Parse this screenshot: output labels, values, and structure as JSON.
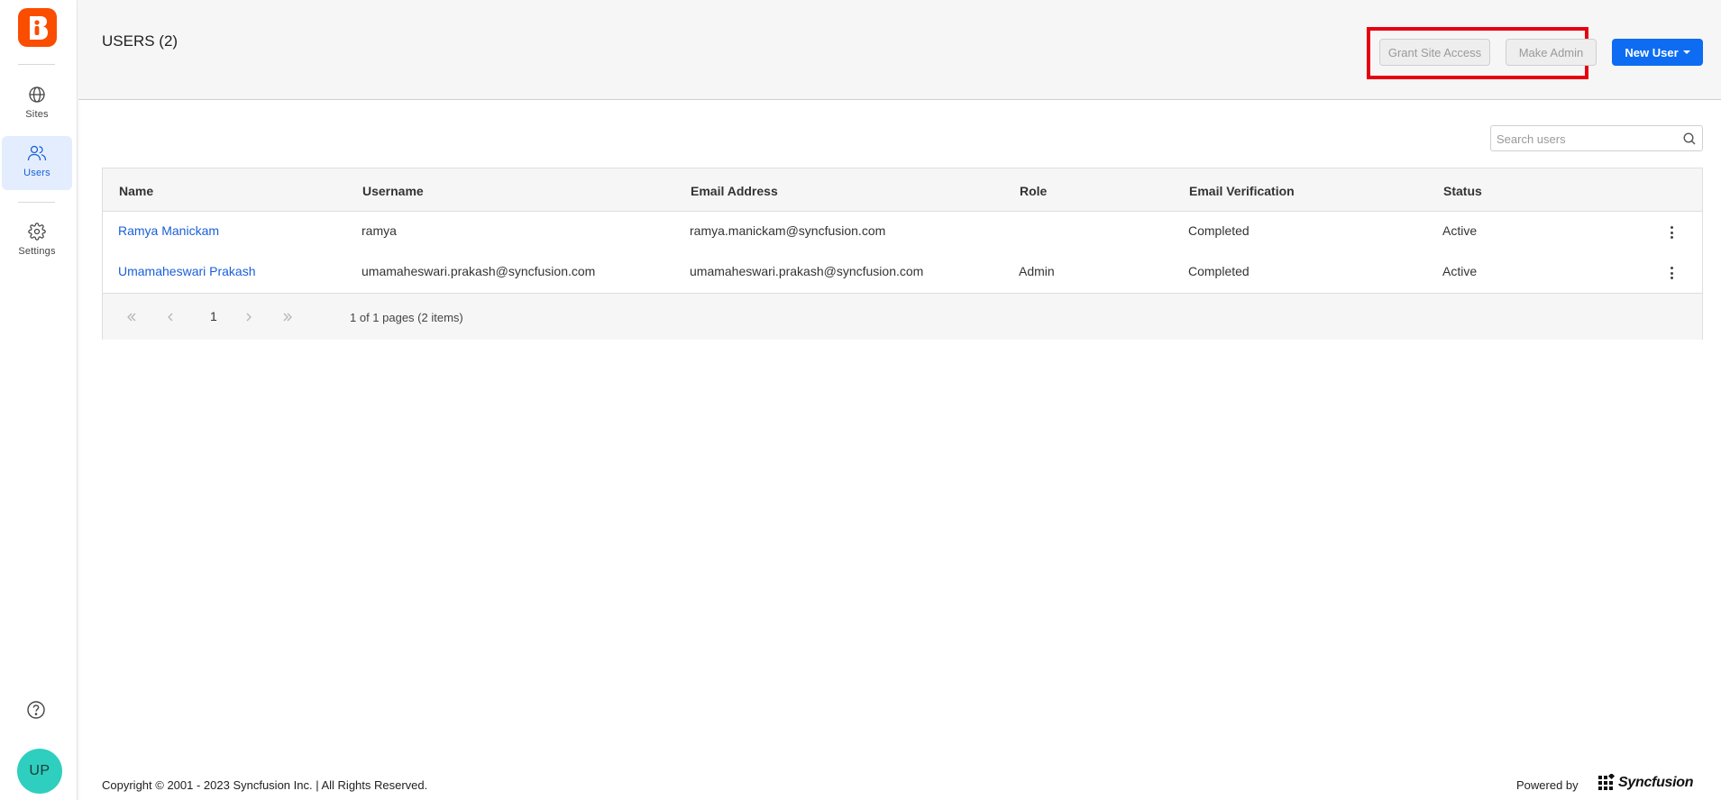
{
  "sidebar": {
    "items": [
      {
        "label": "Sites",
        "icon": "globe-icon",
        "active": false
      },
      {
        "label": "Users",
        "icon": "users-icon",
        "active": true
      },
      {
        "label": "Settings",
        "icon": "gear-icon",
        "active": false
      }
    ],
    "avatar_initials": "UP"
  },
  "header": {
    "title": "USERS (2)",
    "grant_site_access_label": "Grant Site Access",
    "make_admin_label": "Make Admin",
    "new_user_label": "New User"
  },
  "search": {
    "placeholder": "Search users"
  },
  "table": {
    "columns": [
      "Name",
      "Username",
      "Email Address",
      "Role",
      "Email Verification",
      "Status"
    ],
    "rows": [
      {
        "name": "Ramya Manickam",
        "username": "ramya",
        "email": "ramya.manickam@syncfusion.com",
        "role": "",
        "verification": "Completed",
        "status": "Active"
      },
      {
        "name": "Umamaheswari Prakash",
        "username": "umamaheswari.prakash@syncfusion.com",
        "email": "umamaheswari.prakash@syncfusion.com",
        "role": "Admin",
        "verification": "Completed",
        "status": "Active"
      }
    ]
  },
  "pager": {
    "current_page": "1",
    "info": "1 of 1 pages (2 items)"
  },
  "footer": {
    "copyright": "Copyright © 2001 - 2023 Syncfusion Inc. | All Rights Reserved.",
    "powered_by": "Powered by",
    "brand": "Syncfusion"
  },
  "colors": {
    "accent": "#0d6cf2",
    "logo": "#fb4d00",
    "avatar": "#2ecfbf",
    "highlight_box": "#e60012",
    "link": "#1a5fd9"
  }
}
